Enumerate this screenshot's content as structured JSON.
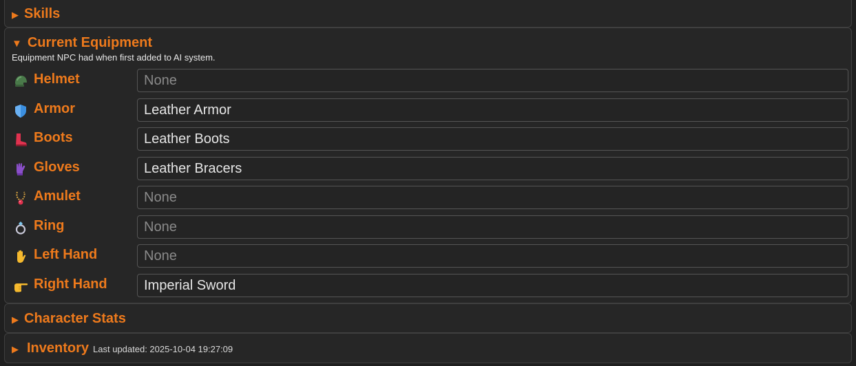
{
  "sections": {
    "skills": {
      "title": "Skills",
      "arrow": "▶"
    },
    "equipment": {
      "title": "Current Equipment",
      "arrow": "▼",
      "description": "Equipment NPC had when first added to AI system.",
      "slots": [
        {
          "label": "Helmet",
          "icon": "helmet-icon",
          "value": "",
          "placeholder": "None"
        },
        {
          "label": "Armor",
          "icon": "shield-icon",
          "value": "Leather Armor",
          "placeholder": "None"
        },
        {
          "label": "Boots",
          "icon": "boot-icon",
          "value": "Leather Boots",
          "placeholder": "None"
        },
        {
          "label": "Gloves",
          "icon": "glove-icon",
          "value": "Leather Bracers",
          "placeholder": "None"
        },
        {
          "label": "Amulet",
          "icon": "amulet-icon",
          "value": "",
          "placeholder": "None"
        },
        {
          "label": "Ring",
          "icon": "ring-icon",
          "value": "",
          "placeholder": "None"
        },
        {
          "label": "Left Hand",
          "icon": "raised-hand-icon",
          "value": "",
          "placeholder": "None"
        },
        {
          "label": "Right Hand",
          "icon": "pointing-hand-icon",
          "value": "Imperial Sword",
          "placeholder": "None"
        }
      ]
    },
    "stats": {
      "title": "Character Stats",
      "arrow": "▶"
    },
    "inventory": {
      "title": "Inventory",
      "arrow": "▶",
      "updated": "Last updated: 2025-10-04 19:27:09"
    }
  },
  "colors": {
    "accent": "#ee7a1c",
    "panel": "#262626",
    "background": "#1f1f1f",
    "border": "#3f3f3f"
  }
}
